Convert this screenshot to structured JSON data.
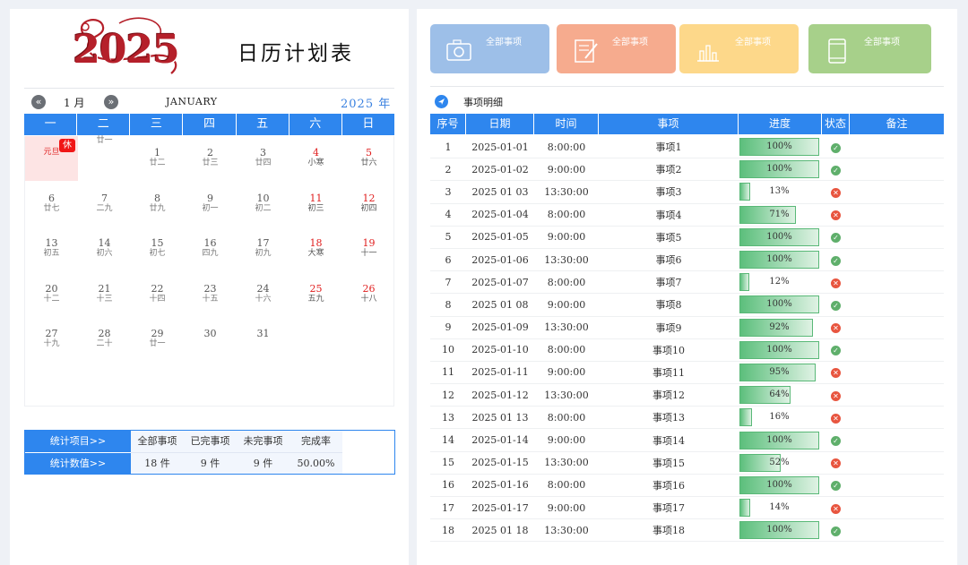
{
  "header": {
    "logo_text": "2025",
    "title": "日历计划表"
  },
  "nav": {
    "prev_icon": "«",
    "next_icon": "»",
    "month": "1 月",
    "month_en": "JANUARY",
    "year": "2025 年"
  },
  "weekdays": [
    "一",
    "二",
    "三",
    "四",
    "五",
    "六",
    "日"
  ],
  "days": [
    {
      "num": "",
      "lunar": "元旦",
      "col": 0,
      "row": 0,
      "holiday": "休",
      "today": true
    },
    {
      "num": "",
      "lunar": "廿一",
      "col": 1,
      "row": 0
    },
    {
      "num": "1",
      "lunar": "廿二",
      "col": 2,
      "row": 0
    },
    {
      "num": "2",
      "lunar": "廿三",
      "col": 3,
      "row": 0
    },
    {
      "num": "3",
      "lunar": "廿四",
      "col": 4,
      "row": 0
    },
    {
      "num": "4",
      "lunar": "小寒",
      "col": 5,
      "row": 0,
      "red": true
    },
    {
      "num": "5",
      "lunar": "廿六",
      "col": 6,
      "row": 0,
      "red": true
    },
    {
      "num": "6",
      "lunar": "廿七",
      "col": 0,
      "row": 1
    },
    {
      "num": "7",
      "lunar": "二九",
      "col": 1,
      "row": 1
    },
    {
      "num": "8",
      "lunar": "廿九",
      "col": 2,
      "row": 1
    },
    {
      "num": "9",
      "lunar": "初一",
      "col": 3,
      "row": 1
    },
    {
      "num": "10",
      "lunar": "初二",
      "col": 4,
      "row": 1
    },
    {
      "num": "11",
      "lunar": "初三",
      "col": 5,
      "row": 1,
      "red": true
    },
    {
      "num": "12",
      "lunar": "初四",
      "col": 6,
      "row": 1,
      "red": true
    },
    {
      "num": "13",
      "lunar": "初五",
      "col": 0,
      "row": 2
    },
    {
      "num": "14",
      "lunar": "初六",
      "col": 1,
      "row": 2
    },
    {
      "num": "15",
      "lunar": "初七",
      "col": 2,
      "row": 2
    },
    {
      "num": "16",
      "lunar": "四九",
      "col": 3,
      "row": 2
    },
    {
      "num": "17",
      "lunar": "初九",
      "col": 4,
      "row": 2
    },
    {
      "num": "18",
      "lunar": "大寒",
      "col": 5,
      "row": 2,
      "red": true
    },
    {
      "num": "19",
      "lunar": "十一",
      "col": 6,
      "row": 2,
      "red": true
    },
    {
      "num": "20",
      "lunar": "十二",
      "col": 0,
      "row": 3
    },
    {
      "num": "21",
      "lunar": "十三",
      "col": 1,
      "row": 3
    },
    {
      "num": "22",
      "lunar": "十四",
      "col": 2,
      "row": 3
    },
    {
      "num": "23",
      "lunar": "十五",
      "col": 3,
      "row": 3
    },
    {
      "num": "24",
      "lunar": "十六",
      "col": 4,
      "row": 3
    },
    {
      "num": "25",
      "lunar": "五九",
      "col": 5,
      "row": 3,
      "red": true
    },
    {
      "num": "26",
      "lunar": "十八",
      "col": 6,
      "row": 3,
      "red": true
    },
    {
      "num": "27",
      "lunar": "十九",
      "col": 0,
      "row": 4
    },
    {
      "num": "28",
      "lunar": "二十",
      "col": 1,
      "row": 4
    },
    {
      "num": "29",
      "lunar": "廿一",
      "col": 2,
      "row": 4
    },
    {
      "num": "30",
      "lunar": "",
      "col": 3,
      "row": 4
    },
    {
      "num": "31",
      "lunar": "",
      "col": 4,
      "row": 4
    }
  ],
  "stats": {
    "row1_label": "统计项目>>",
    "row2_label": "统计数值>>",
    "headers": [
      "全部事项",
      "已完事项",
      "未完事项",
      "完成率"
    ],
    "values": [
      "18 件",
      "9 件",
      "9 件",
      "50.00%"
    ]
  },
  "cards": [
    {
      "label": "全部事项",
      "color": "#9dbfe8",
      "icon": "camera-icon"
    },
    {
      "label": "全部事项",
      "color": "#f6ab8e",
      "icon": "edit-document-icon"
    },
    {
      "label": "全部事项",
      "color": "#fdd88a",
      "icon": "bar-chart-icon"
    },
    {
      "label": "全部事项",
      "color": "#a7d08a",
      "icon": "tablet-icon"
    }
  ],
  "section": {
    "title": "事项明细",
    "icon": "navigation-arrow-icon"
  },
  "table": {
    "headers": [
      "序号",
      "日期",
      "时间",
      "事项",
      "进度",
      "状态",
      "备注"
    ],
    "rows": [
      {
        "no": "1",
        "date": "2025-01-01",
        "time": "8:00:00",
        "item": "事项1",
        "progress": 1.0,
        "pct": "100%",
        "status": "ok"
      },
      {
        "no": "2",
        "date": "2025-01-02",
        "time": "9:00:00",
        "item": "事项2",
        "progress": 1.0,
        "pct": "100%",
        "status": "ok"
      },
      {
        "no": "3",
        "date": "2025 01 03",
        "time": "13:30:00",
        "item": "事项3",
        "progress": 0.13,
        "pct": "13%",
        "status": "no"
      },
      {
        "no": "4",
        "date": "2025-01-04",
        "time": "8:00:00",
        "item": "事项4",
        "progress": 0.71,
        "pct": "71%",
        "status": "no"
      },
      {
        "no": "5",
        "date": "2025-01-05",
        "time": "9:00:00",
        "item": "事项5",
        "progress": 1.0,
        "pct": "100%",
        "status": "ok"
      },
      {
        "no": "6",
        "date": "2025-01-06",
        "time": "13:30:00",
        "item": "事项6",
        "progress": 1.0,
        "pct": "100%",
        "status": "ok"
      },
      {
        "no": "7",
        "date": "2025-01-07",
        "time": "8:00:00",
        "item": "事项7",
        "progress": 0.12,
        "pct": "12%",
        "status": "no"
      },
      {
        "no": "8",
        "date": "2025 01 08",
        "time": "9:00:00",
        "item": "事项8",
        "progress": 1.0,
        "pct": "100%",
        "status": "ok"
      },
      {
        "no": "9",
        "date": "2025-01-09",
        "time": "13:30:00",
        "item": "事项9",
        "progress": 0.92,
        "pct": "92%",
        "status": "no"
      },
      {
        "no": "10",
        "date": "2025-01-10",
        "time": "8:00:00",
        "item": "事项10",
        "progress": 1.0,
        "pct": "100%",
        "status": "ok"
      },
      {
        "no": "11",
        "date": "2025-01-11",
        "time": "9:00:00",
        "item": "事项11",
        "progress": 0.95,
        "pct": "95%",
        "status": "no"
      },
      {
        "no": "12",
        "date": "2025-01-12",
        "time": "13:30:00",
        "item": "事项12",
        "progress": 0.64,
        "pct": "64%",
        "status": "no"
      },
      {
        "no": "13",
        "date": "2025 01 13",
        "time": "8:00:00",
        "item": "事项13",
        "progress": 0.16,
        "pct": "16%",
        "status": "no"
      },
      {
        "no": "14",
        "date": "2025-01-14",
        "time": "9:00:00",
        "item": "事项14",
        "progress": 1.0,
        "pct": "100%",
        "status": "ok"
      },
      {
        "no": "15",
        "date": "2025-01-15",
        "time": "13:30:00",
        "item": "事项15",
        "progress": 0.52,
        "pct": "52%",
        "status": "no"
      },
      {
        "no": "16",
        "date": "2025-01-16",
        "time": "8:00:00",
        "item": "事项16",
        "progress": 1.0,
        "pct": "100%",
        "status": "ok"
      },
      {
        "no": "17",
        "date": "2025-01-17",
        "time": "9:00:00",
        "item": "事项17",
        "progress": 0.14,
        "pct": "14%",
        "status": "no"
      },
      {
        "no": "18",
        "date": "2025 01 18",
        "time": "13:30:00",
        "item": "事项18",
        "progress": 1.0,
        "pct": "100%",
        "status": "ok"
      }
    ]
  }
}
